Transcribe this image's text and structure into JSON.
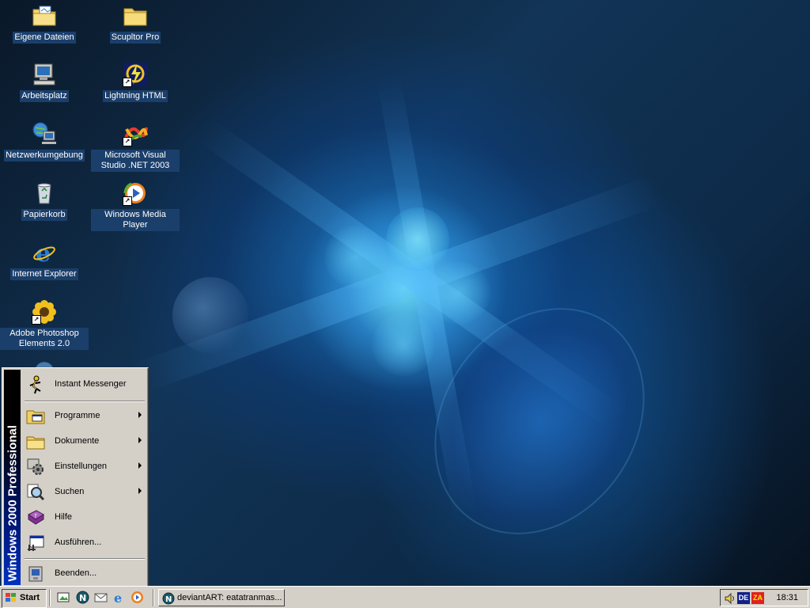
{
  "desktop": {
    "icons": [
      {
        "label": "Eigene Dateien",
        "icon": "my-documents-folder-icon"
      },
      {
        "label": "Arbeitsplatz",
        "icon": "my-computer-icon"
      },
      {
        "label": "Netzwerkumgebung",
        "icon": "network-places-icon"
      },
      {
        "label": "Papierkorb",
        "icon": "recycle-bin-icon"
      },
      {
        "label": "Internet Explorer",
        "icon": "internet-explorer-icon"
      },
      {
        "label": "Adobe Photoshop Elements 2.0",
        "icon": "sunflower-icon"
      },
      {
        "label": "Scupltor Pro",
        "icon": "folder-icon"
      },
      {
        "label": "Lightning HTML",
        "icon": "lightning-html-icon"
      },
      {
        "label": "Microsoft Visual Studio .NET 2003",
        "icon": "visual-studio-icon"
      },
      {
        "label": "Windows Media Player",
        "icon": "media-player-icon"
      }
    ]
  },
  "start_menu": {
    "banner": "Windows 2000 Professional",
    "items": [
      {
        "label": "Instant Messenger",
        "icon": "aim-running-man-icon",
        "submenu": false
      },
      {
        "label": "Programme",
        "icon": "programs-folder-icon",
        "submenu": true
      },
      {
        "label": "Dokumente",
        "icon": "documents-folder-icon",
        "submenu": true
      },
      {
        "label": "Einstellungen",
        "icon": "settings-gear-icon",
        "submenu": true
      },
      {
        "label": "Suchen",
        "icon": "search-magnifier-icon",
        "submenu": true
      },
      {
        "label": "Hilfe",
        "icon": "help-book-icon",
        "submenu": false
      },
      {
        "label": "Ausführen...",
        "icon": "run-icon",
        "submenu": false
      },
      {
        "label": "Beenden...",
        "icon": "shutdown-icon",
        "submenu": false
      }
    ]
  },
  "taskbar": {
    "start_label": "Start",
    "quick_launch": [
      "show-desktop-icon",
      "netscape-icon",
      "outlook-express-icon",
      "internet-explorer-icon",
      "media-player-icon"
    ],
    "tasks": [
      {
        "label": "deviantART: eatatranmas...",
        "icon": "netscape-icon"
      }
    ],
    "tray": {
      "language": "DE",
      "zonealarm": "ZA",
      "clock": "18:31"
    }
  }
}
